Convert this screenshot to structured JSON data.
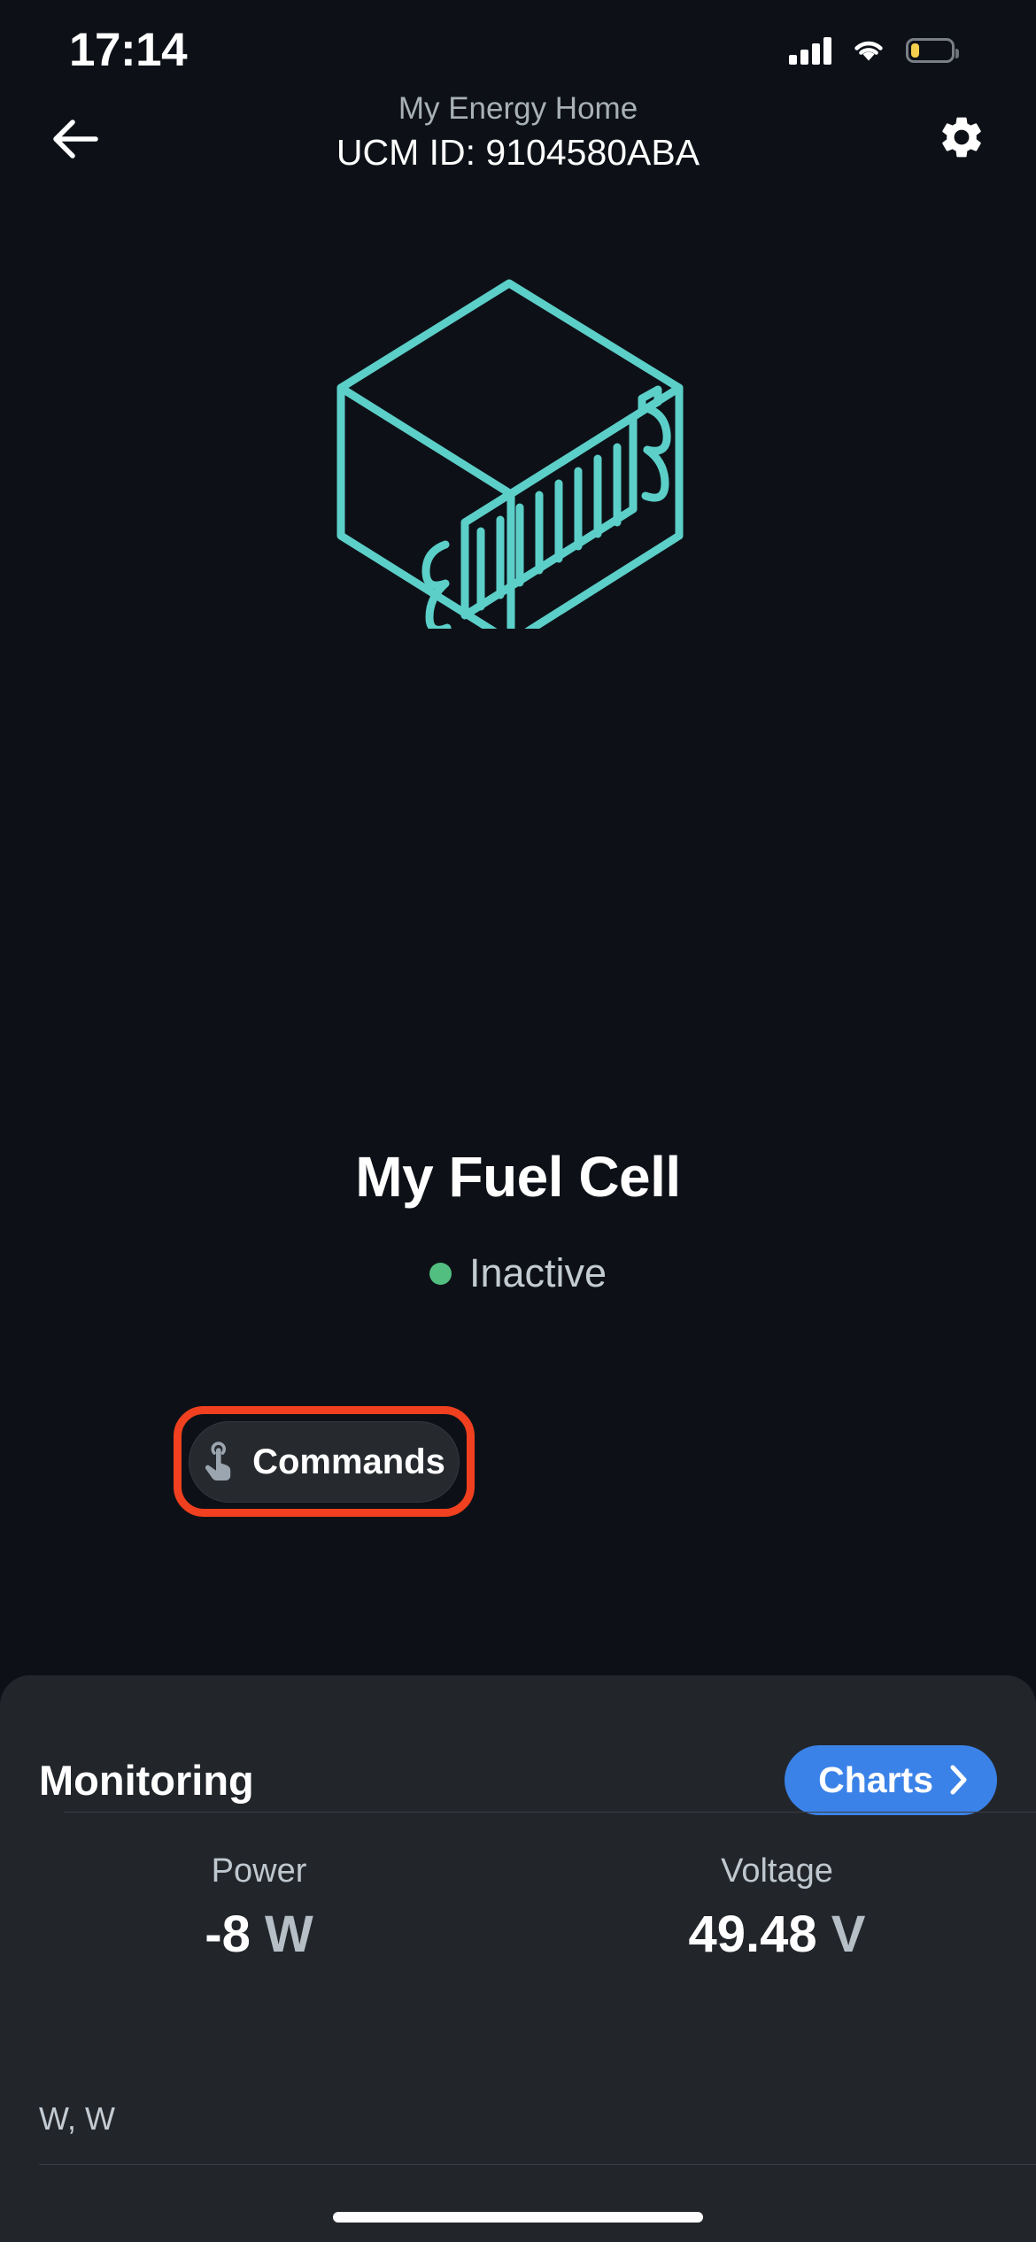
{
  "status_bar": {
    "time": "17:14",
    "signal_icon": "cellular-signal-icon",
    "wifi_icon": "wifi-icon",
    "battery_icon": "battery-low-icon",
    "battery_level_percent": 22,
    "battery_color": "#F5D04E"
  },
  "nav": {
    "back_icon": "arrow-left-icon",
    "subtitle": "My Energy Home",
    "title": "UCM ID: 9104580ABA",
    "settings_icon": "gear-icon"
  },
  "device": {
    "illustration_icon": "fuel-cell-unit-icon",
    "illustration_color": "#5CCFC9",
    "name": "My Fuel Cell",
    "status_text": "Inactive",
    "status_color": "#52BE80"
  },
  "commands": {
    "label": "Commands",
    "icon": "tap-gesture-icon",
    "highlight_color": "#F0401F"
  },
  "monitoring": {
    "title": "Monitoring",
    "charts_label": "Charts",
    "charts_chevron_icon": "chevron-right-icon",
    "charts_color": "#3B82E8",
    "metrics": [
      {
        "label": "Power",
        "value": "-8",
        "unit": "W"
      },
      {
        "label": "Voltage",
        "value": "49.48",
        "unit": "V"
      }
    ],
    "footer_text": "W, W"
  }
}
